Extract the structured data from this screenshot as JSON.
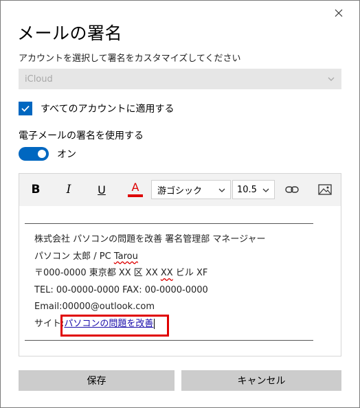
{
  "window": {
    "title": "メールの署名",
    "subtitle": "アカウントを選択して署名をカスタマイズしてください"
  },
  "account": {
    "selected": "iCloud"
  },
  "apply_all": {
    "label": "すべてのアカウントに適用する",
    "checked": true
  },
  "use_signature": {
    "label": "電子メールの署名を使用する",
    "toggle_label": "オン",
    "on": true
  },
  "toolbar": {
    "bold": "B",
    "italic": "I",
    "underline": "U",
    "font_color": "A",
    "font_family": "游ゴシック",
    "font_size": "10.5",
    "font_color_value": "#dd0000"
  },
  "signature": {
    "line1": "株式会社 パソコンの問題を改善 署名管理部 マネージャー",
    "line2_prefix": "パソコン 太郎 / PC ",
    "line2_squiggle": "Tarou",
    "line3_a": "〒000-0000 東京都 XX 区 XX ",
    "line3_squiggle": "XX",
    "line3_b": " ビル XF",
    "line4": "TEL: 00-0000-0000 FAX: 00-0000-0000",
    "line5": "Email:00000@outlook.com",
    "line6_prefix": "サイト:",
    "line6_link": "パソコンの問題を改善"
  },
  "buttons": {
    "save": "保存",
    "cancel": "キャンセル"
  },
  "colors": {
    "accent": "#0067c0",
    "highlight": "#e00000",
    "link": "#1a0dab"
  }
}
